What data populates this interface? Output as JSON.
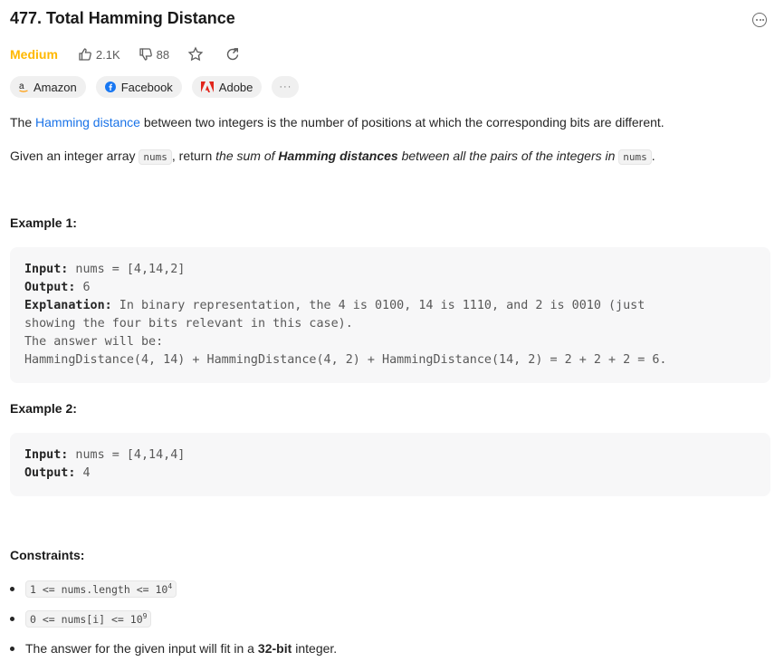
{
  "problem": {
    "title": "477. Total Hamming Distance",
    "difficulty": "Medium",
    "likes": "2.1K",
    "dislikes": "88"
  },
  "tags": [
    {
      "name": "Amazon",
      "icon": "amazon-logo"
    },
    {
      "name": "Facebook",
      "icon": "facebook-logo"
    },
    {
      "name": "Adobe",
      "icon": "adobe-logo"
    }
  ],
  "tags_more": "···",
  "description": {
    "p1_prefix": "The ",
    "p1_link": "Hamming distance",
    "p1_suffix": " between two integers is the number of positions at which the corresponding bits are different.",
    "p2_a": "Given an integer array ",
    "p2_code1": "nums",
    "p2_b": ", return ",
    "p2_italic1": "the sum of ",
    "p2_bold": "Hamming distances",
    "p2_italic2": " between all the pairs of the integers in ",
    "p2_code2": "nums",
    "p2_end": "."
  },
  "examples": [
    {
      "heading": "Example 1:",
      "input_label": "Input:",
      "input_value": " nums = [4,14,2]",
      "output_label": "Output:",
      "output_value": " 6",
      "explanation_label": "Explanation:",
      "explanation_lines": [
        " In binary representation, the 4 is 0100, 14 is 1110, and 2 is 0010 (just",
        "showing the four bits relevant in this case).",
        "The answer will be:",
        "HammingDistance(4, 14) + HammingDistance(4, 2) + HammingDistance(14, 2) = 2 + 2 + 2 = 6."
      ]
    },
    {
      "heading": "Example 2:",
      "input_label": "Input:",
      "input_value": " nums = [4,14,4]",
      "output_label": "Output:",
      "output_value": " 4"
    }
  ],
  "constraints": {
    "heading": "Constraints:",
    "c1_code": "1 <= nums.length <= 10",
    "c1_sup": "4",
    "c2_code": "0 <= nums[i] <= 10",
    "c2_sup": "9",
    "c3_a": "The answer for the given input will fit in a ",
    "c3_bold": "32-bit",
    "c3_b": " integer."
  },
  "colors": {
    "difficulty_medium": "#ffb800",
    "link": "#1a73e8"
  }
}
